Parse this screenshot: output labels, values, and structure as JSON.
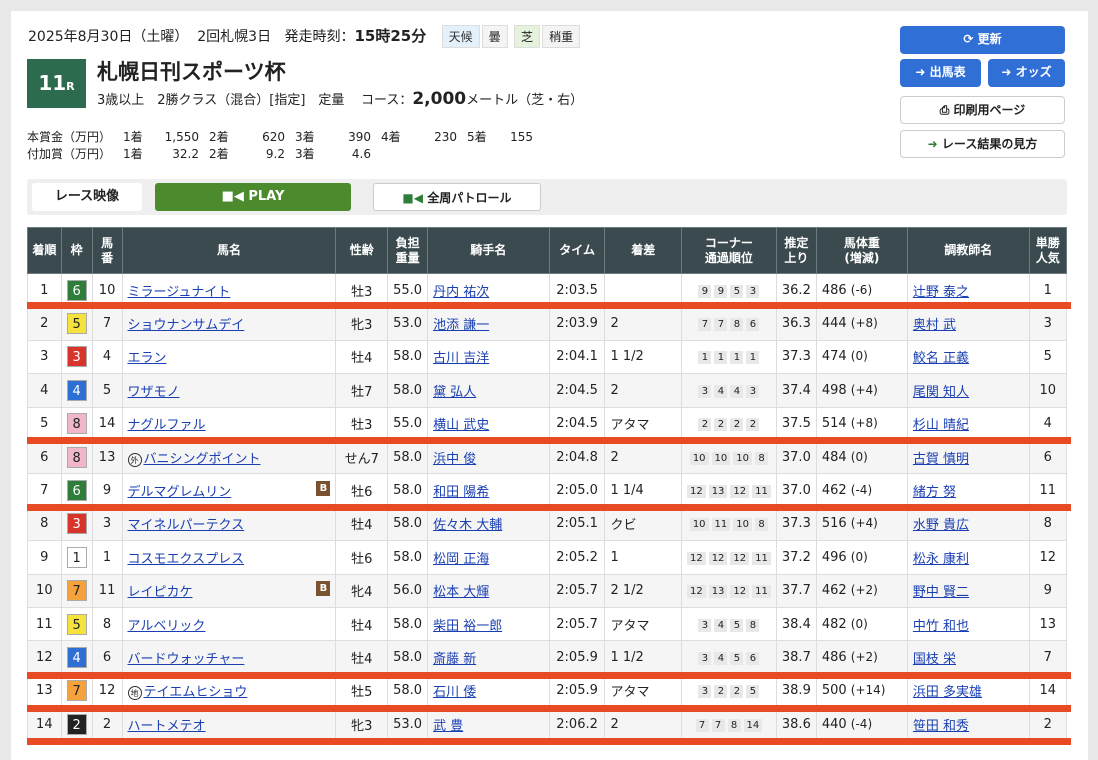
{
  "header": {
    "date": "2025年8月30日（土曜）",
    "meeting": "2回札幌3日",
    "post_label": "発走時刻：",
    "post_time": "15時25分",
    "weather_label": "天候",
    "weather": "曇",
    "track_label": "芝",
    "track_cond": "稍重"
  },
  "race": {
    "num": "11",
    "r": "R",
    "name": "札幌日刊スポーツ杯",
    "cond": "3歳以上　2勝クラス（混合）[指定]　定量",
    "course_label": "コース：",
    "distance": "2,000",
    "dist_unit": "メートル（芝・右）"
  },
  "prize": {
    "main_label": "本賞金（万円）",
    "main": [
      "1着",
      "1,550",
      "2着",
      "620",
      "3着",
      "390",
      "4着",
      "230",
      "5着",
      "155"
    ],
    "add_label": "付加賞（万円）",
    "add": [
      "1着",
      "32.2",
      "2着",
      "9.2",
      "3着",
      "4.6"
    ]
  },
  "buttons": {
    "refresh": "更新",
    "entries": "出馬表",
    "odds": "オッズ",
    "print": "印刷用ページ",
    "howto": "レース結果の見方"
  },
  "video": {
    "label": "レース映像",
    "play": "PLAY",
    "patrol": "全周パトロール"
  },
  "table": {
    "headers": [
      "着順",
      "枠",
      "馬番",
      "馬名",
      "性齢",
      "負担重量",
      "騎手名",
      "タイム",
      "着差",
      "コーナー通過順位",
      "推定上り",
      "馬体重(増減)",
      "調教師名",
      "単勝人気"
    ],
    "rows": [
      {
        "pos": "1",
        "waku": "6",
        "num": "10",
        "name": "ミラージュナイト",
        "tag": "",
        "b": "",
        "sex": "牡3",
        "wt": "55.0",
        "jockey": "丹内 祐次",
        "time": "2:03.5",
        "margin": "",
        "corner": [
          "9",
          "9",
          "5",
          "3"
        ],
        "last": "36.2",
        "bw": "486",
        "bwd": "(-6)",
        "trainer": "辻野 泰之",
        "pop": "1"
      },
      {
        "pos": "2",
        "waku": "5",
        "num": "7",
        "name": "ショウナンサムデイ",
        "tag": "",
        "b": "",
        "sex": "牝3",
        "wt": "53.0",
        "jockey": "池添 謙一",
        "time": "2:03.9",
        "margin": "2",
        "corner": [
          "7",
          "7",
          "8",
          "6"
        ],
        "last": "36.3",
        "bw": "444",
        "bwd": "(+8)",
        "trainer": "奥村 武",
        "pop": "3"
      },
      {
        "pos": "3",
        "waku": "3",
        "num": "4",
        "name": "エラン",
        "tag": "",
        "b": "",
        "sex": "牡4",
        "wt": "58.0",
        "jockey": "古川 吉洋",
        "time": "2:04.1",
        "margin": "1 1/2",
        "corner": [
          "1",
          "1",
          "1",
          "1"
        ],
        "last": "37.3",
        "bw": "474",
        "bwd": "(0)",
        "trainer": "鮫名 正義",
        "pop": "5"
      },
      {
        "pos": "4",
        "waku": "4",
        "num": "5",
        "name": "ワザモノ",
        "tag": "",
        "b": "",
        "sex": "牡7",
        "wt": "58.0",
        "jockey": "黛 弘人",
        "time": "2:04.5",
        "margin": "2",
        "corner": [
          "3",
          "4",
          "4",
          "3"
        ],
        "last": "37.4",
        "bw": "498",
        "bwd": "(+4)",
        "trainer": "尾関 知人",
        "pop": "10"
      },
      {
        "pos": "5",
        "waku": "8",
        "num": "14",
        "name": "ナグルファル",
        "tag": "",
        "b": "",
        "sex": "牡3",
        "wt": "55.0",
        "jockey": "横山 武史",
        "time": "2:04.5",
        "margin": "アタマ",
        "corner": [
          "2",
          "2",
          "2",
          "2"
        ],
        "last": "37.5",
        "bw": "514",
        "bwd": "(+8)",
        "trainer": "杉山 晴紀",
        "pop": "4"
      },
      {
        "pos": "6",
        "waku": "8",
        "num": "13",
        "name": "バニシングポイント",
        "tag": "外",
        "b": "",
        "sex": "せん7",
        "wt": "58.0",
        "jockey": "浜中 俊",
        "time": "2:04.8",
        "margin": "2",
        "corner": [
          "10",
          "10",
          "10",
          "8"
        ],
        "last": "37.0",
        "bw": "484",
        "bwd": "(0)",
        "trainer": "古賀 慎明",
        "pop": "6"
      },
      {
        "pos": "7",
        "waku": "6",
        "num": "9",
        "name": "デルマグレムリン",
        "tag": "",
        "b": "B",
        "sex": "牡6",
        "wt": "58.0",
        "jockey": "和田 陽希",
        "time": "2:05.0",
        "margin": "1 1/4",
        "corner": [
          "12",
          "13",
          "12",
          "11"
        ],
        "last": "37.0",
        "bw": "462",
        "bwd": "(-4)",
        "trainer": "緒方 努",
        "pop": "11"
      },
      {
        "pos": "8",
        "waku": "3",
        "num": "3",
        "name": "マイネルパーテクス",
        "tag": "",
        "b": "",
        "sex": "牡4",
        "wt": "58.0",
        "jockey": "佐々木 大輔",
        "time": "2:05.1",
        "margin": "クビ",
        "corner": [
          "10",
          "11",
          "10",
          "8"
        ],
        "last": "37.3",
        "bw": "516",
        "bwd": "(+4)",
        "trainer": "水野 貴広",
        "pop": "8"
      },
      {
        "pos": "9",
        "waku": "1",
        "num": "1",
        "name": "コスモエクスプレス",
        "tag": "",
        "b": "",
        "sex": "牡6",
        "wt": "58.0",
        "jockey": "松岡 正海",
        "time": "2:05.2",
        "margin": "1",
        "corner": [
          "12",
          "12",
          "12",
          "11"
        ],
        "last": "37.2",
        "bw": "496",
        "bwd": "(0)",
        "trainer": "松永 康利",
        "pop": "12"
      },
      {
        "pos": "10",
        "waku": "7",
        "num": "11",
        "name": "レイピカケ",
        "tag": "",
        "b": "B",
        "sex": "牝4",
        "wt": "56.0",
        "jockey": "松本 大輝",
        "time": "2:05.7",
        "margin": "2 1/2",
        "corner": [
          "12",
          "13",
          "12",
          "11"
        ],
        "last": "37.7",
        "bw": "462",
        "bwd": "(+2)",
        "trainer": "野中 賢二",
        "pop": "9"
      },
      {
        "pos": "11",
        "waku": "5",
        "num": "8",
        "name": "アルベリック",
        "tag": "",
        "b": "",
        "sex": "牡4",
        "wt": "58.0",
        "jockey": "柴田 裕一郎",
        "time": "2:05.7",
        "margin": "アタマ",
        "corner": [
          "3",
          "4",
          "5",
          "8"
        ],
        "last": "38.4",
        "bw": "482",
        "bwd": "(0)",
        "trainer": "中竹 和也",
        "pop": "13"
      },
      {
        "pos": "12",
        "waku": "4",
        "num": "6",
        "name": "バードウォッチャー",
        "tag": "",
        "b": "",
        "sex": "牡4",
        "wt": "58.0",
        "jockey": "斎藤 新",
        "time": "2:05.9",
        "margin": "1 1/2",
        "corner": [
          "3",
          "4",
          "5",
          "6"
        ],
        "last": "38.7",
        "bw": "486",
        "bwd": "(+2)",
        "trainer": "国枝 栄",
        "pop": "7"
      },
      {
        "pos": "13",
        "waku": "7",
        "num": "12",
        "name": "テイエムヒショウ",
        "tag": "地",
        "b": "",
        "sex": "牡5",
        "wt": "58.0",
        "jockey": "石川 倭",
        "time": "2:05.9",
        "margin": "アタマ",
        "corner": [
          "3",
          "2",
          "2",
          "5"
        ],
        "last": "38.9",
        "bw": "500",
        "bwd": "(+14)",
        "trainer": "浜田 多実雄",
        "pop": "14"
      },
      {
        "pos": "14",
        "waku": "2",
        "num": "2",
        "name": "ハートメテオ",
        "tag": "",
        "b": "",
        "sex": "牝3",
        "wt": "53.0",
        "jockey": "武 豊",
        "time": "2:06.2",
        "margin": "2",
        "corner": [
          "7",
          "7",
          "8",
          "14"
        ],
        "last": "38.6",
        "bw": "440",
        "bwd": "(-4)",
        "trainer": "笹田 和秀",
        "pop": "2"
      }
    ]
  },
  "waku_colors": {
    "1": [
      "#ffffff",
      "#222"
    ],
    "2": [
      "#222222",
      "#fff"
    ],
    "3": [
      "#d9342b",
      "#fff"
    ],
    "4": [
      "#2d6fd2",
      "#fff"
    ],
    "5": [
      "#f5e23c",
      "#222"
    ],
    "6": [
      "#2f7d3a",
      "#fff"
    ],
    "7": [
      "#f5a13c",
      "#222"
    ],
    "8": [
      "#f0b7c8",
      "#222"
    ]
  }
}
